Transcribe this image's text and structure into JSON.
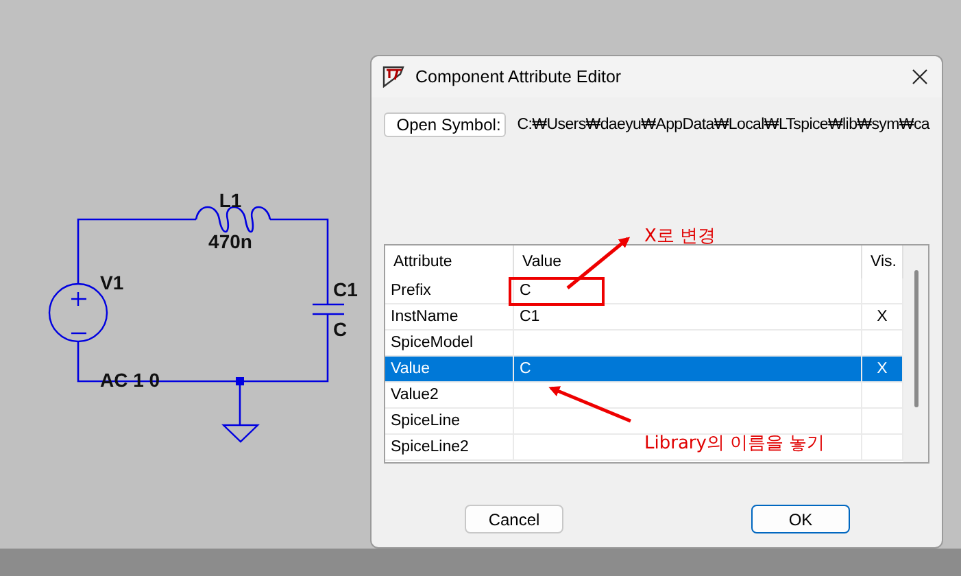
{
  "schematic": {
    "labels": [
      {
        "kind": "inductor_name",
        "text": "L1"
      },
      {
        "kind": "inductor_value",
        "text": "470n"
      },
      {
        "kind": "source_name",
        "text": "V1"
      },
      {
        "kind": "source_value",
        "text": "AC 1 0"
      },
      {
        "kind": "capacitor_name",
        "text": "C1"
      },
      {
        "kind": "capacitor_value",
        "text": "C"
      }
    ]
  },
  "window": {
    "title": "Component Attribute Editor"
  },
  "open_symbol": {
    "button": "Open Symbol:",
    "path": "C:₩Users₩daeyu₩AppData₩Local₩LTspice₩lib₩sym₩ca"
  },
  "table": {
    "columns": [
      "Attribute",
      "Value",
      "Vis."
    ],
    "rows": [
      {
        "attribute": "Prefix",
        "value": "C",
        "vis": "",
        "selected": false
      },
      {
        "attribute": "InstName",
        "value": "C1",
        "vis": "X",
        "selected": false
      },
      {
        "attribute": "SpiceModel",
        "value": "",
        "vis": "",
        "selected": false
      },
      {
        "attribute": "Value",
        "value": "C",
        "vis": "X",
        "selected": true
      },
      {
        "attribute": "Value2",
        "value": "",
        "vis": "",
        "selected": false
      },
      {
        "attribute": "SpiceLine",
        "value": "",
        "vis": "",
        "selected": false
      },
      {
        "attribute": "SpiceLine2",
        "value": "",
        "vis": "",
        "selected": false
      }
    ]
  },
  "buttons": [
    {
      "label": "Cancel",
      "default": false
    },
    {
      "label": "OK",
      "default": true
    }
  ],
  "annotations": [
    {
      "text": "X로 변경"
    },
    {
      "text": "Library의 이름을 놓기"
    }
  ]
}
